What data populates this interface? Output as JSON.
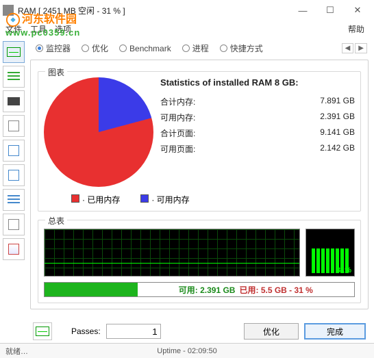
{
  "window": {
    "title": "RAM [ 2451 MB 空闲 - 31 % ]"
  },
  "menu": {
    "file": "文件",
    "tools": "工具",
    "options": "选项",
    "help": "帮助"
  },
  "tabs": {
    "monitor": "监控器",
    "optimize": "优化",
    "benchmark": "Benchmark",
    "process": "进程",
    "shortcut": "快捷方式"
  },
  "groups": {
    "chart": "图表",
    "summary": "总表"
  },
  "stats": {
    "title": "Statistics of installed RAM 8 GB:",
    "total_mem_label": "合计内存:",
    "total_mem_value": "7.891 GB",
    "avail_mem_label": "可用内存:",
    "avail_mem_value": "2.391 GB",
    "total_page_label": "合计页面:",
    "total_page_value": "9.141 GB",
    "avail_page_label": "可用页面:",
    "avail_page_value": "2.142 GB"
  },
  "legend": {
    "used": "· 已用内存",
    "free": "· 可用内存"
  },
  "vu": {
    "percent": "31%"
  },
  "usage": {
    "free_label": "可用:",
    "free_value": "2.391 GB",
    "used_label": "已用:",
    "used_value": "5.5 GB - 31 %"
  },
  "bottom": {
    "passes_label": "Passes:",
    "passes_value": "1",
    "optimize_btn": "优化",
    "done_btn": "完成"
  },
  "status": {
    "ready": "就绪…",
    "uptime_label": "Uptime",
    "uptime_value": "02:09:50"
  },
  "watermark": {
    "text": "河东软件园",
    "url": "www.pc0359.cn"
  },
  "chart_data": {
    "type": "pie",
    "title": "Statistics of installed RAM 8 GB",
    "series": [
      {
        "name": "已用内存",
        "value": 5.5,
        "color": "#e83030"
      },
      {
        "name": "可用内存",
        "value": 2.391,
        "color": "#3b3be8"
      }
    ],
    "unit": "GB",
    "percent_used": 31
  }
}
